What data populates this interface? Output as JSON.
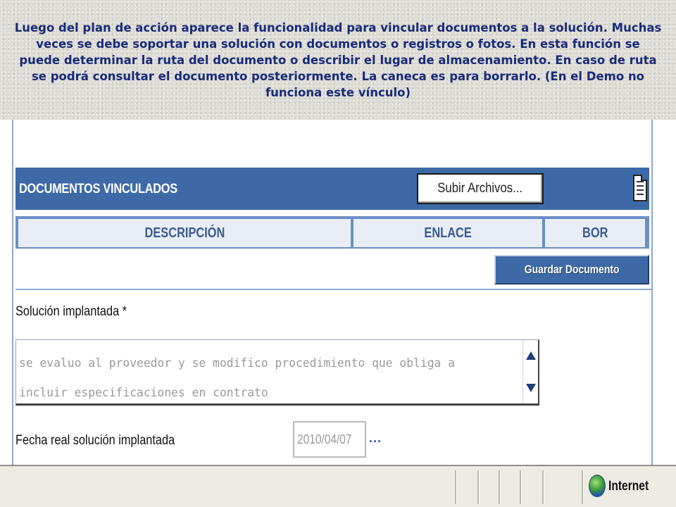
{
  "caption": {
    "text": "Luego del plan de acción aparece la funcionalidad para vincular documentos a la solución. Muchas veces se debe soportar una solución con documentos o registros o fotos. En esta función se puede determinar la ruta del documento o describir el lugar de almacenamiento. En caso de ruta se podrá consultar el documento posteriormente. La caneca es para borrarlo. (En el Demo no funciona este vínculo)",
    "color": "#1a2a78"
  },
  "documents_section": {
    "title": "DOCUMENTOS VINCULADOS",
    "upload_button_label": "Subir Archivos...",
    "header_color": "#3d6aa6",
    "columns": [
      "DESCRIPCIÓN",
      "ENLACE",
      "BOR"
    ],
    "save_button_label": "Guardar Documento",
    "icons": {
      "delete": "trash-can-icon"
    }
  },
  "solution": {
    "label": "Solución implantada *",
    "value": "se evaluo al proveedor y se modifico procedimiento que obliga a incluir especificaciones en contrato"
  },
  "date_field": {
    "label": "Fecha real solución implantada",
    "value": "2010/04/07",
    "picker_label": "..."
  },
  "statusbar": {
    "zone": "Internet",
    "icons": {
      "zone": "globe-icon"
    }
  }
}
